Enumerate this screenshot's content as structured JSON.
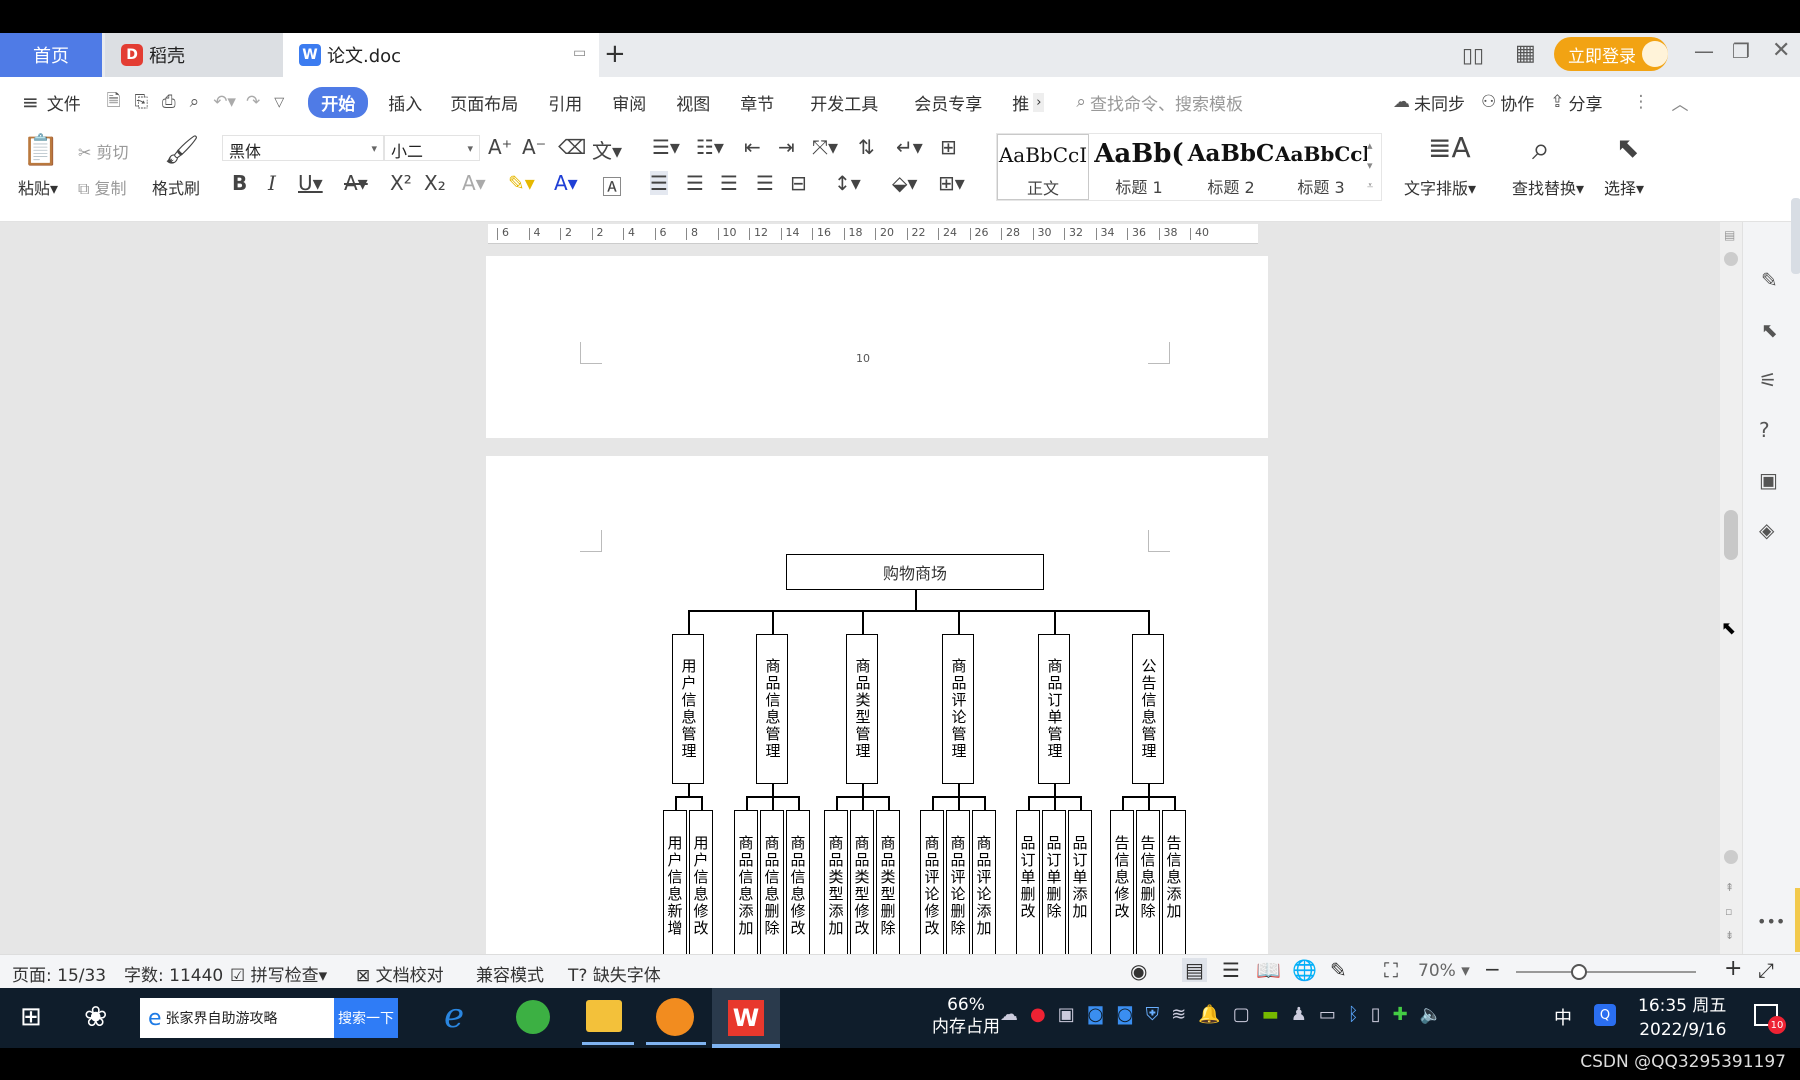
{
  "tabs": {
    "home": "首页",
    "daoke": "稻壳",
    "doc": "论文.doc",
    "login": "立即登录"
  },
  "menu": {
    "file": "文件",
    "items": [
      "开始",
      "插入",
      "页面布局",
      "引用",
      "审阅",
      "视图",
      "章节",
      "开发工具",
      "会员专享",
      "推"
    ],
    "search_placeholder": "查找命令、搜索模板",
    "sync": "未同步",
    "collab": "协作",
    "share": "分享"
  },
  "ribbon": {
    "paste": "粘贴",
    "cut": "剪切",
    "copy": "复制",
    "format_painter": "格式刷",
    "font_name": "黑体",
    "font_size": "小二",
    "styles": [
      {
        "preview": "AaBbCcI",
        "name": "正文"
      },
      {
        "preview": "AaBb(",
        "name": "标题 1"
      },
      {
        "preview": "AaBbC",
        "name": "标题 2"
      },
      {
        "preview": "AaBbCcl",
        "name": "标题 3"
      }
    ],
    "text_layout": "文字排版",
    "find_replace": "查找替换",
    "select": "选择"
  },
  "ruler": {
    "ticks": [
      "6",
      "4",
      "2",
      "2",
      "4",
      "6",
      "8",
      "10",
      "12",
      "14",
      "16",
      "18",
      "20",
      "22",
      "24",
      "26",
      "28",
      "30",
      "32",
      "34",
      "36",
      "38",
      "40"
    ]
  },
  "document": {
    "page_number": "10",
    "diagram": {
      "root": "购物商场",
      "modules": [
        {
          "name": "用户信息管理",
          "children": [
            "用户信息新增",
            "用户信息修改"
          ]
        },
        {
          "name": "商品信息管理",
          "children": [
            "商品信息添加",
            "商品信息删除",
            "商品信息修改"
          ]
        },
        {
          "name": "商品类型管理",
          "children": [
            "商品类型添加",
            "商品类型修改",
            "商品类型删除"
          ]
        },
        {
          "name": "商品评论管理",
          "children": [
            "商品评论修改",
            "商品评论删除",
            "商品评论添加"
          ]
        },
        {
          "name": "商品订单管理",
          "children": [
            "品订单删改",
            "品订单删除",
            "品订单添加"
          ]
        },
        {
          "name": "公告信息管理",
          "children": [
            "告信息修改",
            "告信息删除",
            "告信息添加"
          ]
        }
      ]
    }
  },
  "status": {
    "page": "页面: 15/33",
    "words": "字数: 11440",
    "spell": "拼写检查",
    "proof": "文档校对",
    "compat": "兼容模式",
    "missing_font": "缺失字体",
    "zoom": "70%"
  },
  "taskbar": {
    "search_text": "张家界自助游攻略",
    "search_btn": "搜索一下",
    "mem_pct": "66%",
    "mem_label": "内存占用",
    "ime": "中",
    "time": "16:35 周五",
    "date": "2022/9/16",
    "notif": "10"
  },
  "watermark": "CSDN @QQ3295391197",
  "colors": {
    "accent": "#4f7be6",
    "taskbar": "#0f1d2b",
    "login": "#f2a313"
  }
}
